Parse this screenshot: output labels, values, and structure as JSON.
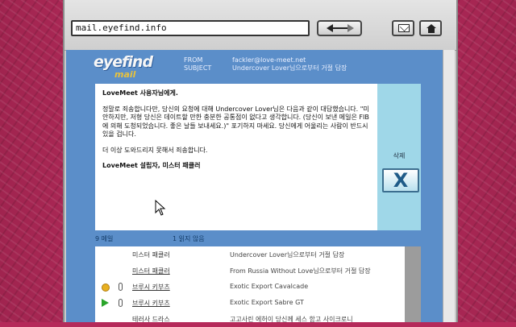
{
  "browser": {
    "url": "mail.eyefind.info"
  },
  "logo": {
    "top": "eyefind",
    "bottom": "mail"
  },
  "header": {
    "from_label": "FROM",
    "subject_label": "SUBJECT",
    "from_value": "fackler@love-meet.net",
    "subject_value": "Undercover Lover님으로부터 거절 답장"
  },
  "message": {
    "greeting": "LoveMeet 사용자님에게.",
    "paragraph1": "정말로 죄송합니다만, 당신의 요청에 대해 Undercover Lover님은 다음과 같이 대답했습니다. \"미안하지만, 저형 당신은 데이트할 만한 충분한 공통점이 없다고 생각합니다. (당신이 보낸 메일은 FIB에 의해 도청되었습니다. 좋은 날들 보내세요.)\" 포기하지 마세요. 당신에게 어울리는 사람이 반드시 있을 겁니다.",
    "paragraph2": "더 이상 도와드리지 못해서 죄송합니다.",
    "signature": "LoveMeet 설립자, 미스터 패클러"
  },
  "delete": {
    "label": "삭제",
    "icon_text": "X"
  },
  "counts": {
    "total": "9 메일",
    "unread": "1 읽지 않음"
  },
  "inbox": [
    {
      "from": "미스터 패클러",
      "subject": "Undercover Lover님으로부터 거절 답장",
      "status": "none",
      "attachment": false,
      "link": false
    },
    {
      "from": "미스터 패클러",
      "subject": "From Russia Without Love님으로부터 거절 답장",
      "status": "none",
      "attachment": false,
      "link": true
    },
    {
      "from": "브루시 키부츠",
      "subject": "Exotic Export Cavalcade",
      "status": "unread",
      "attachment": true,
      "link": true
    },
    {
      "from": "브루시 키부츠",
      "subject": "Exotic Export Sabre GT",
      "status": "play",
      "attachment": true,
      "link": true
    },
    {
      "from": "테러사 드라스",
      "subject": "고고사린 에허이 당신께 세스 함고 사이크로니",
      "status": "none",
      "attachment": false,
      "link": false
    }
  ],
  "colors": {
    "mail_header": "#5b8ec9",
    "delete_panel": "#9fd7e8",
    "page_background": "#b52a5a"
  }
}
